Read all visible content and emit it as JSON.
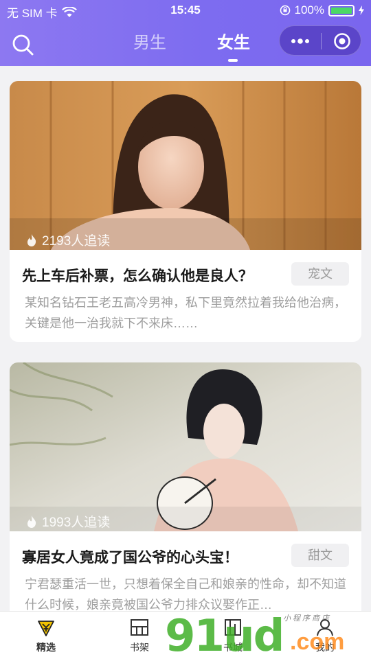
{
  "status_bar": {
    "carrier": "无 SIM 卡",
    "time": "15:45",
    "battery": "100%"
  },
  "header": {
    "tabs": [
      {
        "label": "男生",
        "active": false
      },
      {
        "label": "女生",
        "active": true
      }
    ],
    "icons": {
      "search": "search-icon",
      "more": "more-dots-icon",
      "close": "target-close-icon"
    }
  },
  "cards": [
    {
      "reads": "2193人追读",
      "title": "先上车后补票，怎么确认他是良人？",
      "tag": "宠文",
      "desc": "某知名钻石王老五高冷男神，私下里竟然拉着我给他治病，关键是他一治我就下不来床……"
    },
    {
      "reads": "1993人追读",
      "title": "寡居女人竟成了国公爷的心头宝！",
      "tag": "甜文",
      "desc": "宁君瑟重活一世，只想着保全自己和娘亲的性命，却不知道什么时候，娘亲竟被国公爷力排众议娶作正…"
    }
  ],
  "tabbar": [
    {
      "label": "精选",
      "icon": "featured-icon",
      "active": true
    },
    {
      "label": "书架",
      "icon": "bookshelf-icon",
      "active": false
    },
    {
      "label": "书城",
      "icon": "bookstore-icon",
      "active": false
    },
    {
      "label": "我的",
      "icon": "profile-icon",
      "active": false
    }
  ],
  "watermark": {
    "main": "91ud",
    "suffix": ".com",
    "small": "小程序商店"
  },
  "colors": {
    "header_start": "#8d78f1",
    "header_end": "#7a66ee",
    "capsule": "#5b45c9",
    "featured_icon": "#f2c300"
  }
}
